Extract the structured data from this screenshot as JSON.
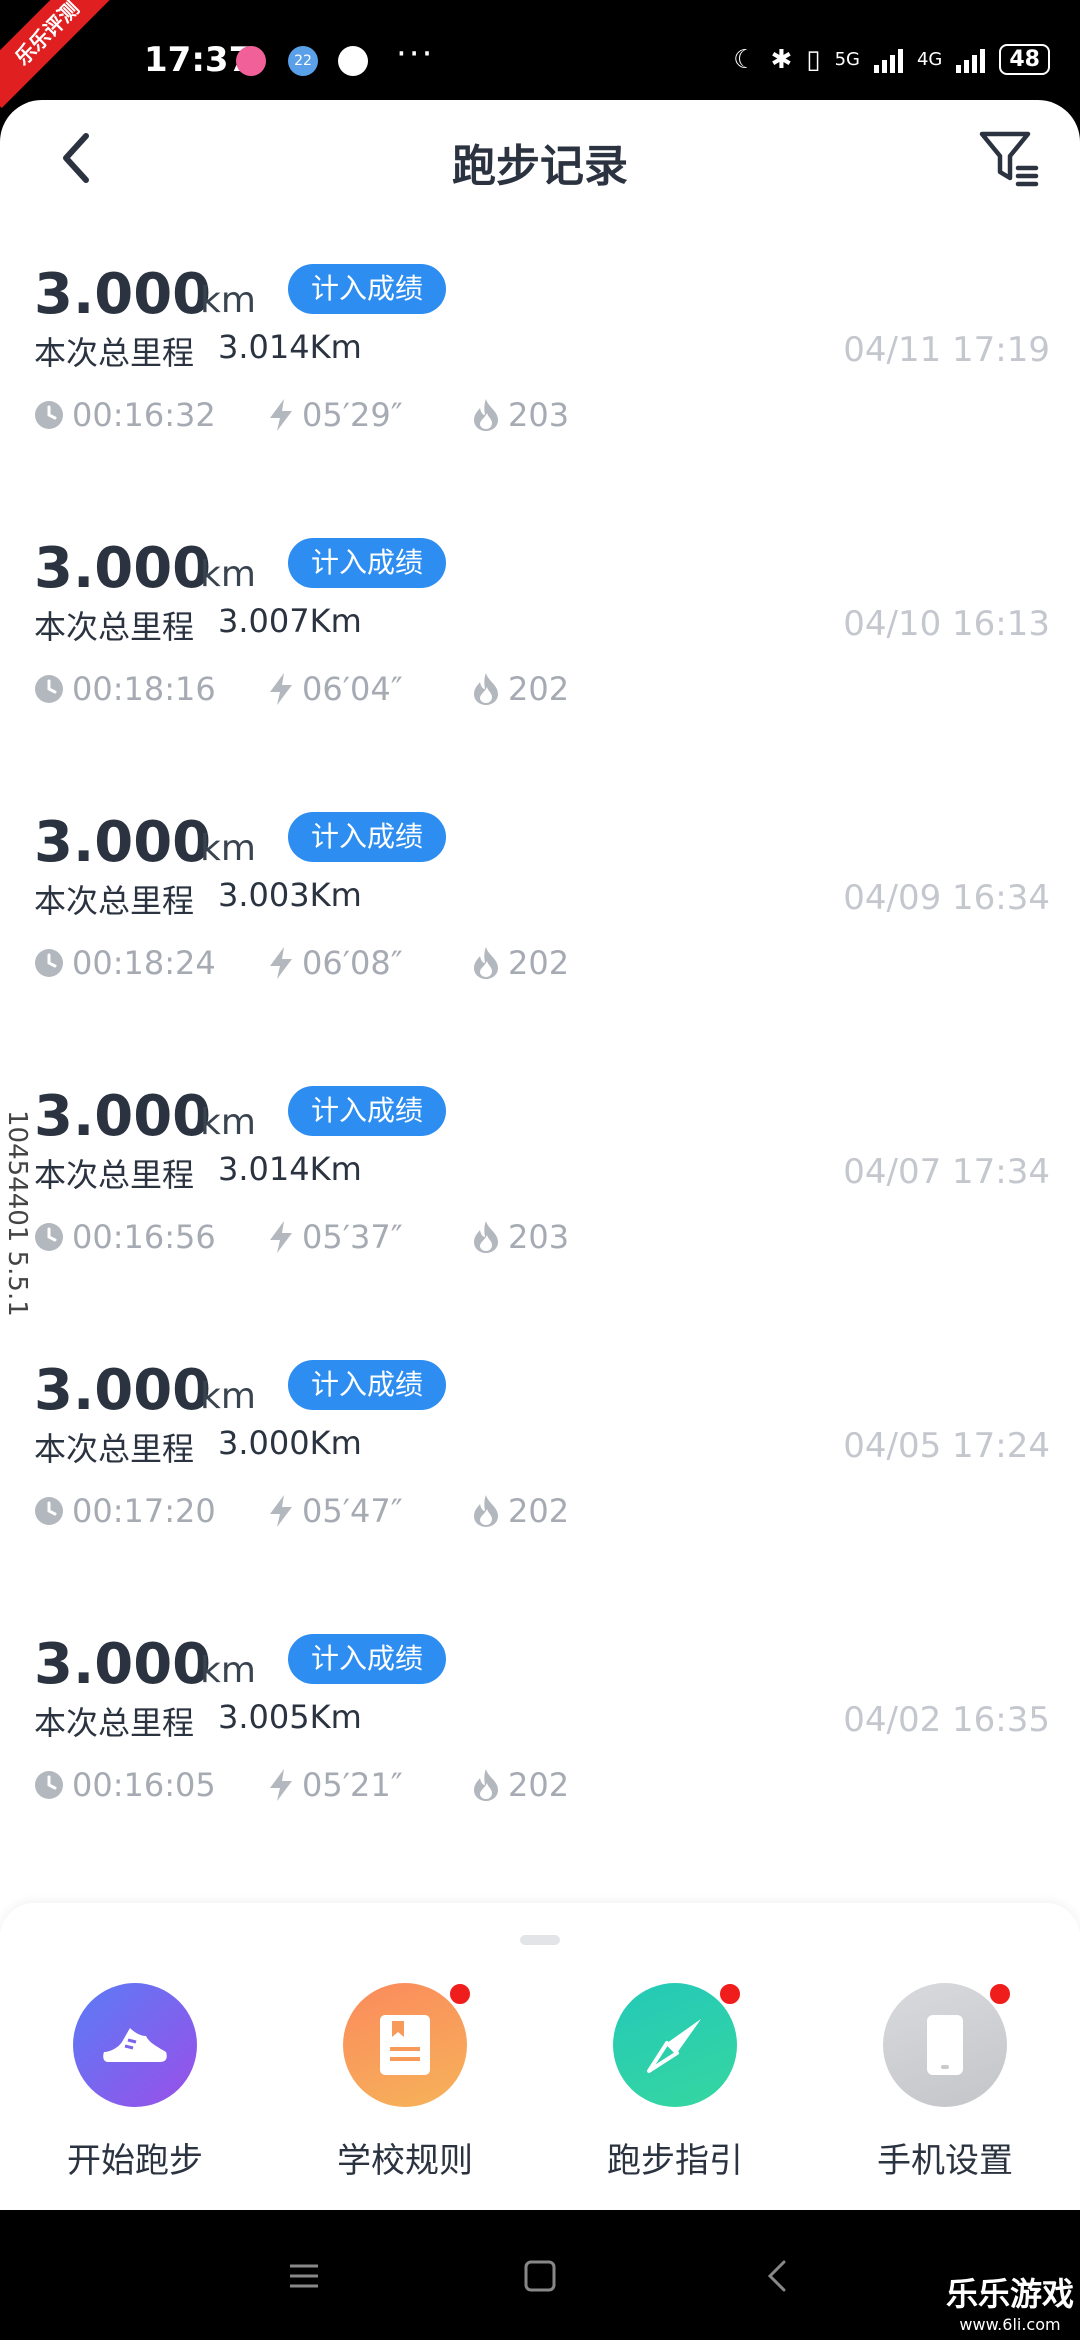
{
  "status_bar": {
    "time": "17:37",
    "notification_badge": "22",
    "more": "···",
    "network_1": "5G",
    "network_2": "4G",
    "battery": "48",
    "corner_tag": "乐乐评测"
  },
  "header": {
    "title": "跑步记录"
  },
  "records": [
    {
      "distance": "3.000",
      "unit": "km",
      "badge": "计入成绩",
      "total_label": "本次总里程",
      "total_value": "3.014Km",
      "date": "04/11 17:19",
      "duration": "00:16:32",
      "pace": "05′29″",
      "calories": "203"
    },
    {
      "distance": "3.000",
      "unit": "km",
      "badge": "计入成绩",
      "total_label": "本次总里程",
      "total_value": "3.007Km",
      "date": "04/10 16:13",
      "duration": "00:18:16",
      "pace": "06′04″",
      "calories": "202"
    },
    {
      "distance": "3.000",
      "unit": "km",
      "badge": "计入成绩",
      "total_label": "本次总里程",
      "total_value": "3.003Km",
      "date": "04/09 16:34",
      "duration": "00:18:24",
      "pace": "06′08″",
      "calories": "202"
    },
    {
      "distance": "3.000",
      "unit": "km",
      "badge": "计入成绩",
      "total_label": "本次总里程",
      "total_value": "3.014Km",
      "date": "04/07 17:34",
      "duration": "00:16:56",
      "pace": "05′37″",
      "calories": "203"
    },
    {
      "distance": "3.000",
      "unit": "km",
      "badge": "计入成绩",
      "total_label": "本次总里程",
      "total_value": "3.000Km",
      "date": "04/05 17:24",
      "duration": "00:17:20",
      "pace": "05′47″",
      "calories": "202"
    },
    {
      "distance": "3.000",
      "unit": "km",
      "badge": "计入成绩",
      "total_label": "本次总里程",
      "total_value": "3.005Km",
      "date": "04/02 16:35",
      "duration": "00:16:05",
      "pace": "05′21″",
      "calories": "202"
    }
  ],
  "side_text": "10454401 5.5.1",
  "actions": [
    {
      "label": "开始跑步",
      "icon": "running-shoe-icon",
      "badge": false
    },
    {
      "label": "学校规则",
      "icon": "rulebook-icon",
      "badge": true
    },
    {
      "label": "跑步指引",
      "icon": "compass-icon",
      "badge": true
    },
    {
      "label": "手机设置",
      "icon": "phone-icon",
      "badge": true
    }
  ],
  "watermark": {
    "title": "乐乐游戏",
    "url": "www.6li.com"
  },
  "colors": {
    "accent": "#2d8df0",
    "text": "#2b3340",
    "muted": "#a6abb3",
    "date": "#c4c8ce",
    "notification_dot": "#f01d1d"
  }
}
